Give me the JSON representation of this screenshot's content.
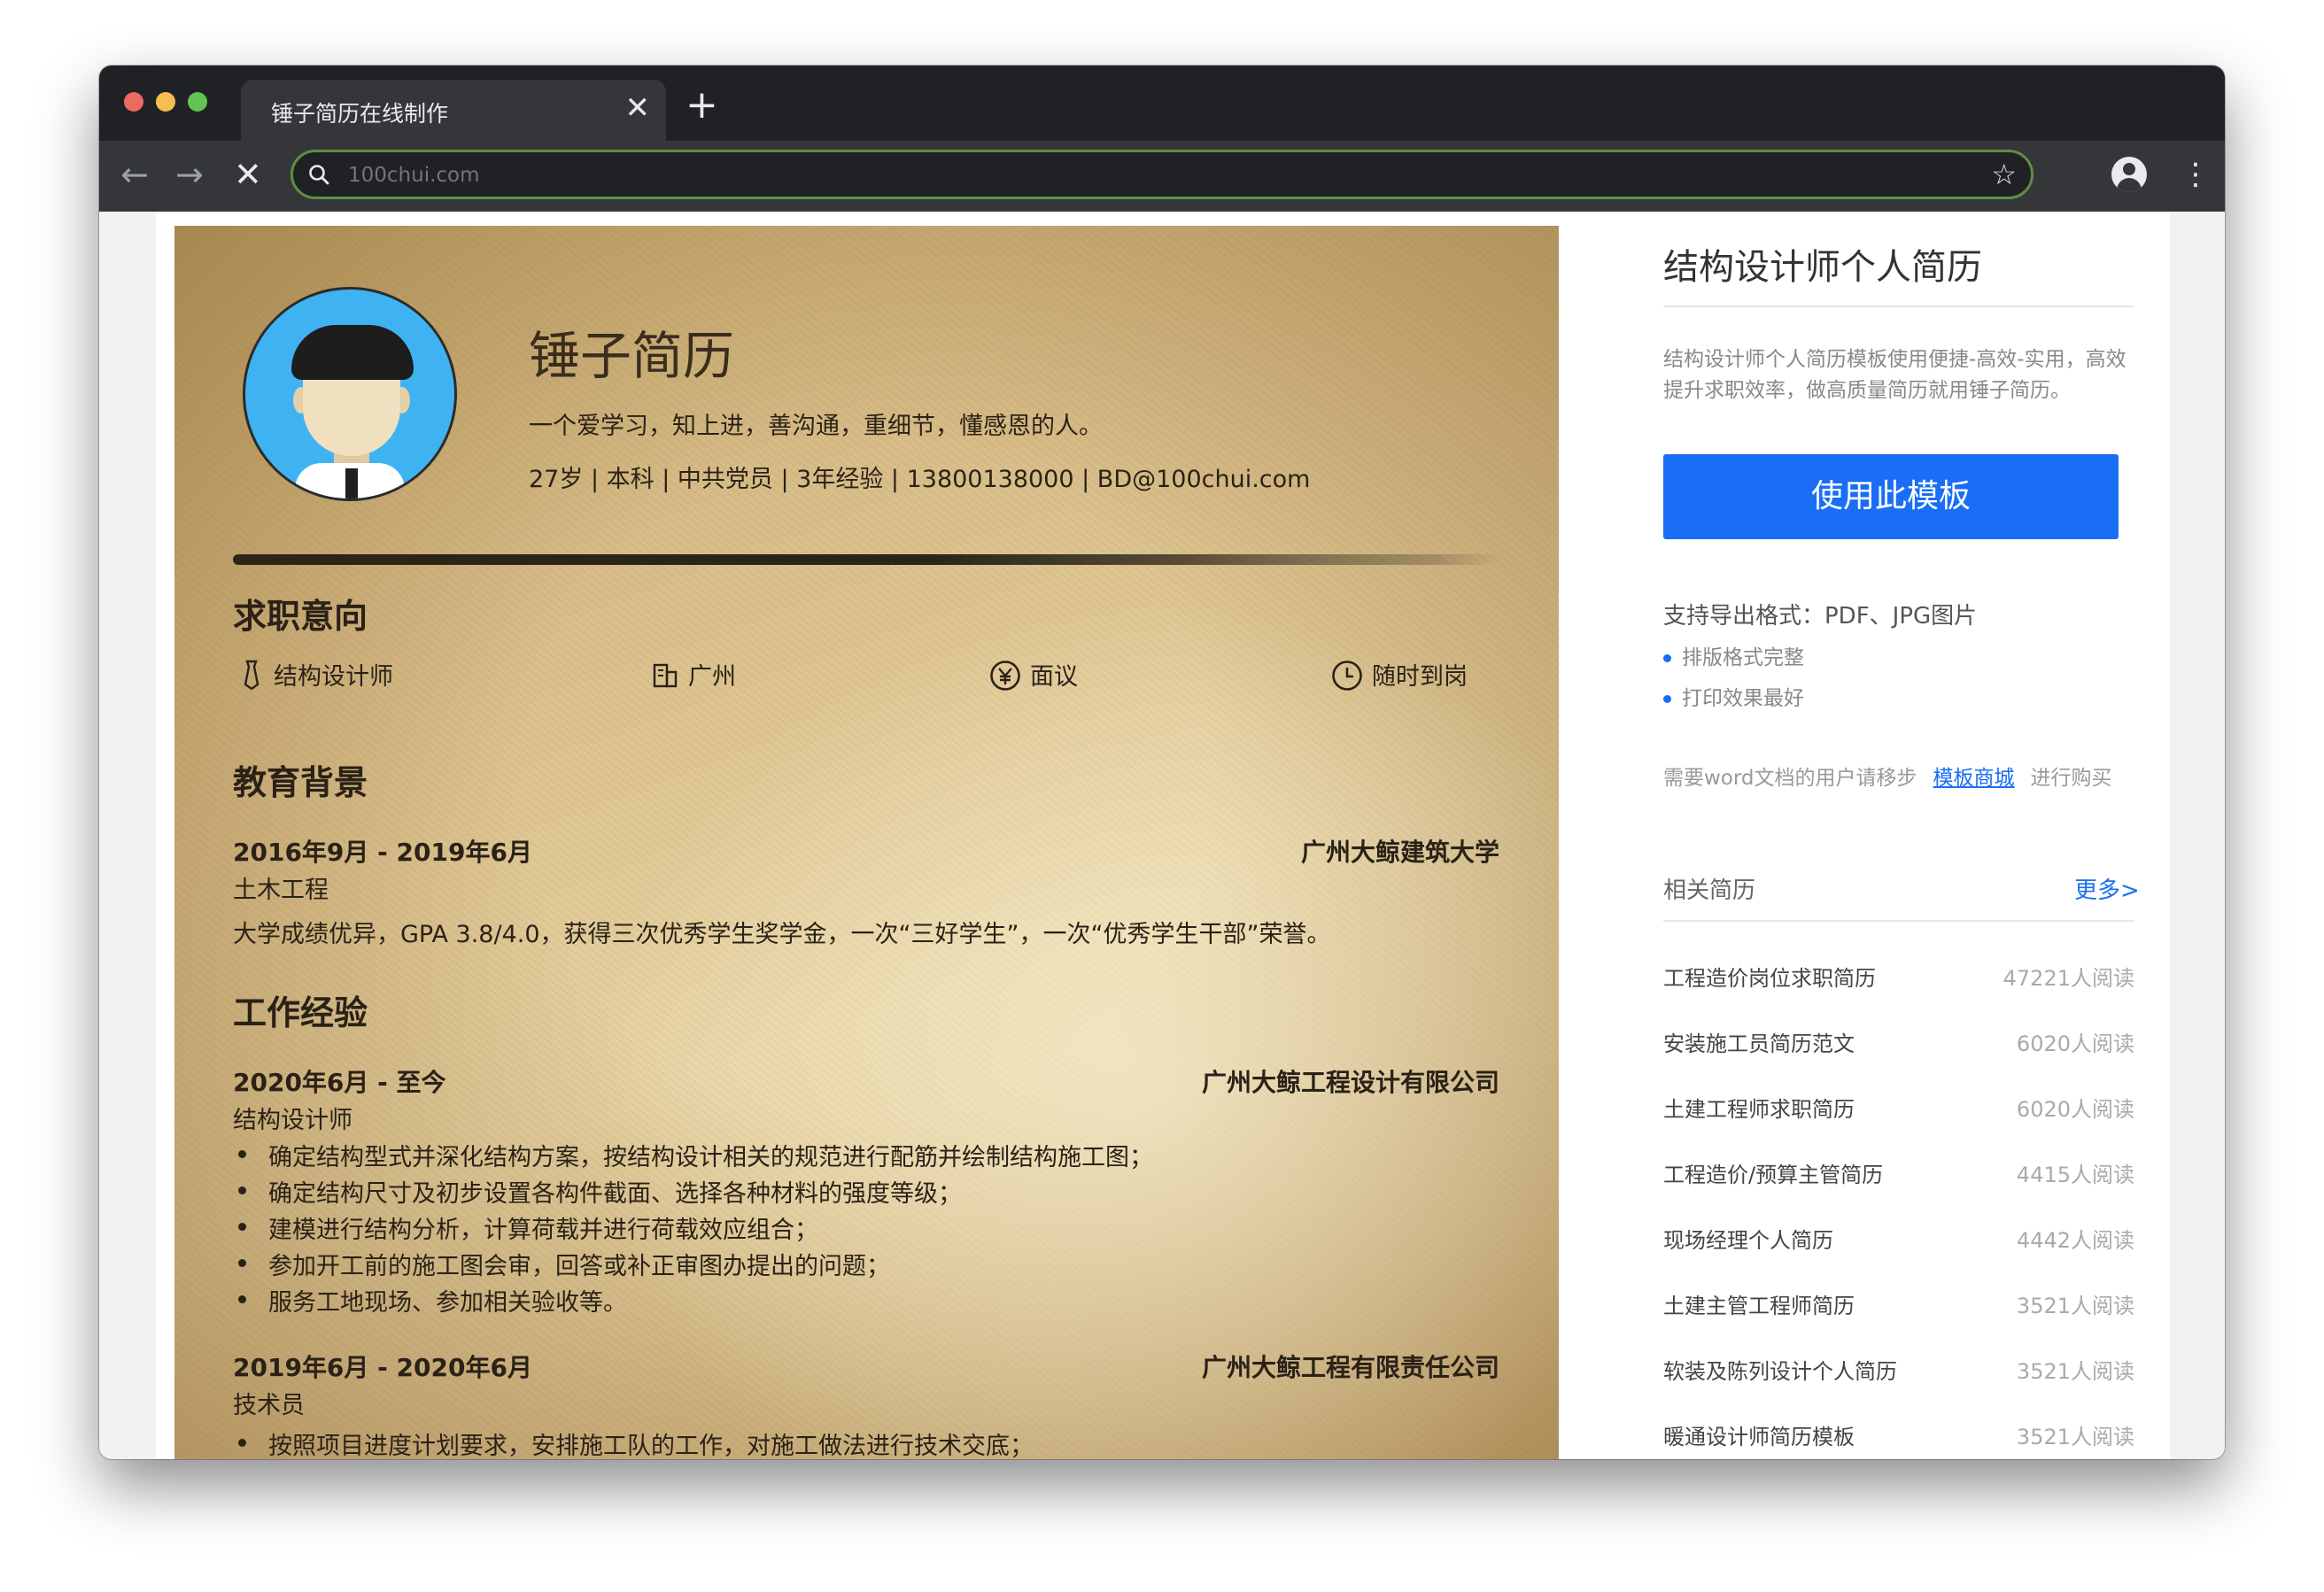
{
  "browser": {
    "tab_title": "锤子简历在线制作",
    "tab_close": "✕",
    "new_tab": "+",
    "address_placeholder": "100chui.com",
    "back": "←",
    "forward": "→",
    "stop": "✕",
    "star": "☆",
    "menu": "⋮"
  },
  "resume": {
    "name": "锤子简历",
    "tagline": "一个爱学习，知上进，善沟通，重细节，懂感恩的人。",
    "info": "27岁 | 本科 | 中共党员 | 3年经验 | 13800138000 | BD@100chui.com",
    "intent_title": "求职意向",
    "intent": {
      "position": "结构设计师",
      "city": "广州",
      "salary": "面议",
      "availability": "随时到岗"
    },
    "edu_title": "教育背景",
    "education": {
      "period": "2016年9月 - 2019年6月",
      "school": "广州大鲸建筑大学",
      "major": "土木工程",
      "desc": "大学成绩优异，GPA 3.8/4.0，获得三次优秀学生奖学金，一次“三好学生”，一次“优秀学生干部”荣誉。"
    },
    "work_title": "工作经验",
    "jobs": [
      {
        "period": "2020年6月 - 至今",
        "company": "广州大鲸工程设计有限公司",
        "role": "结构设计师",
        "bullets": [
          "确定结构型式并深化结构方案，按结构设计相关的规范进行配筋并绘制结构施工图；",
          "确定结构尺寸及初步设置各构件截面、选择各种材料的强度等级；",
          "建模进行结构分析，计算荷载并进行荷载效应组合；",
          "参加开工前的施工图会审，回答或补正审图办提出的问题；",
          "服务工地现场、参加相关验收等。"
        ]
      },
      {
        "period": "2019年6月 - 2020年6月",
        "company": "广州大鲸工程有限责任公司",
        "role": "技术员",
        "bullets": [
          "按照项目进度计划要求，安排施工队的工作，对施工做法进行技术交底；"
        ]
      }
    ]
  },
  "sidebar": {
    "title": "结构设计师个人简历",
    "desc": "结构设计师个人简历模板使用便捷-高效-实用，高效提升求职效率，做高质量简历就用锤子简历。",
    "use_button": "使用此模板",
    "export_formats": "支持导出格式：PDF、JPG图片",
    "features": [
      "排版格式完整",
      "打印效果最好"
    ],
    "note_prefix": "需要word文档的用户请移步",
    "note_link": "模板商城",
    "note_suffix": "进行购买",
    "related_title": "相关简历",
    "more": "更多>",
    "related": [
      {
        "name": "工程造价岗位求职简历",
        "count": "47221人阅读"
      },
      {
        "name": "安装施工员简历范文",
        "count": "6020人阅读"
      },
      {
        "name": "土建工程师求职简历",
        "count": "6020人阅读"
      },
      {
        "name": "工程造价/预算主管简历",
        "count": "4415人阅读"
      },
      {
        "name": "现场经理个人简历",
        "count": "4442人阅读"
      },
      {
        "name": "土建主管工程师简历",
        "count": "3521人阅读"
      },
      {
        "name": "软装及陈列设计个人简历",
        "count": "3521人阅读"
      },
      {
        "name": "暖通设计师简历模板",
        "count": "3521人阅读"
      }
    ]
  },
  "icons": {
    "position": "tie-icon",
    "city": "building-icon",
    "salary": "yen-circle-icon",
    "availability": "clock-icon"
  },
  "colors": {
    "accent": "#1a6ef5",
    "browser_frame": "#202124",
    "toolbar": "#35363a"
  }
}
